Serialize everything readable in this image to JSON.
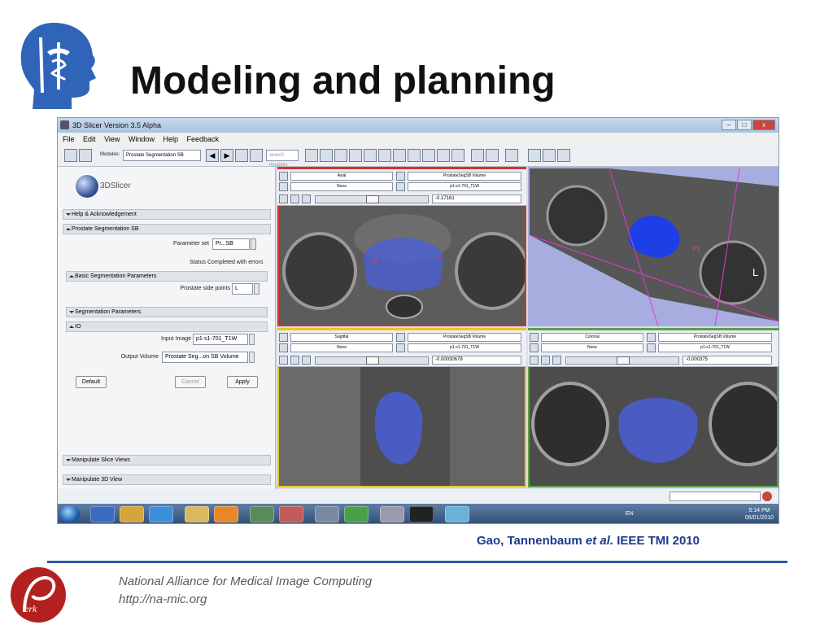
{
  "slide": {
    "title": "Modeling and planning",
    "credit_authors": "Gao, Tannenbaum ",
    "credit_etal": "et al.",
    "credit_journal": " IEEE TMI 2010",
    "footer_line1": "National Alliance for Medical Image Computing",
    "footer_line2": "http://na-mic.org"
  },
  "window": {
    "title": "3D Slicer Version 3.5 Alpha",
    "buttons": [
      "–",
      "□",
      "x"
    ]
  },
  "menu": [
    "File",
    "Edit",
    "View",
    "Window",
    "Help",
    "Feedback"
  ],
  "toolbar": {
    "modules_label": "Modules:",
    "module_value": "Prostate Segmentation SB",
    "search_placeholder": "search modules"
  },
  "left_panel": {
    "brand": "3DSlicer",
    "help_section": "Help & Acknowledgement",
    "module_section": "Prostate Segmentation SB",
    "parameter_set_label": "Parameter set",
    "parameter_set_value": "Pr...SB",
    "status_label": "Status",
    "status_value": "Completed with errors",
    "basic_params_section": "Basic Segmentation Parameters",
    "side_points_label": "Prostate side points",
    "side_points_value": "L",
    "seg_params_section": "Segmentation Parameters",
    "io_section": "IO",
    "input_image_label": "Input Image",
    "input_image_value": "p1-s1-701_T1W",
    "output_volume_label": "Output Volume",
    "output_volume_value": "Prostate Seg...on SB Volume",
    "default_btn": "Default",
    "cancel_btn": "Cancel",
    "apply_btn": "Apply",
    "manip_slice_section": "Manipulate Slice Views",
    "manip_3d_section": "Manipulate 3D View"
  },
  "views": {
    "axial": {
      "orientation": "Axial",
      "label_layer": "ProstateSegSB Volume",
      "fg": "None",
      "bg": "p1-s1-701_T1W",
      "offset": "-0.17161",
      "marker1": "P1",
      "marker2": "P2"
    },
    "sagittal": {
      "orientation": "Sagittal",
      "label_layer": "ProstateSegSB Volume",
      "fg": "None",
      "bg": "p1-s1-701_T1W",
      "offset": "-0.00030679"
    },
    "coronal": {
      "orientation": "Coronal",
      "label_layer": "ProstateSegSB Volume",
      "fg": "None",
      "bg": "p1-s1-701_T1W",
      "offset": "-0.000375"
    },
    "three_d": {
      "marker": "P1",
      "orient_label": "L"
    }
  },
  "taskbar": {
    "lang": "EN",
    "time": "5:14 PM",
    "date": "06/01/2010"
  },
  "colors": {
    "title": "#111111",
    "credit": "#1b3a8c",
    "rule": "#2e5aa8",
    "axial_border": "#d9322a",
    "sagittal_border": "#e6c62e",
    "coronal_border": "#5aa04a",
    "segmentation": "#4a5fd6",
    "view3d_bg": "#a7aedf"
  }
}
